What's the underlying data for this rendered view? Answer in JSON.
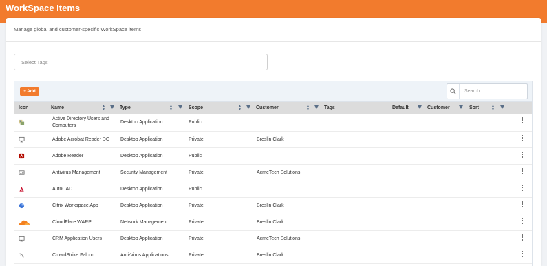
{
  "header": {
    "title": "WorkSpace Items"
  },
  "card": {
    "subtitle": "Manage global and customer-specific WorkSpace items",
    "tags_placeholder": "Select Tags"
  },
  "toolbar": {
    "add_label": "Add",
    "search_placeholder": "Search"
  },
  "columns": {
    "icon": "Icon",
    "name": "Name",
    "type": "Type",
    "scope": "Scope",
    "customer": "Customer",
    "tags": "Tags",
    "default": "Default",
    "customer2": "Customer",
    "sort": "Sort"
  },
  "rows": [
    {
      "icon": "directory-users-icon",
      "name": "Active Directory Users and Computers",
      "type": "Desktop Application",
      "scope": "Public",
      "customer": ""
    },
    {
      "icon": "desktop-monitor-icon",
      "name": "Adobe Acrobat Reader DC",
      "type": "Desktop Application",
      "scope": "Private",
      "customer": "Breslin Clark"
    },
    {
      "icon": "adobe-reader-icon",
      "name": "Adobe Reader",
      "type": "Desktop Application",
      "scope": "Public",
      "customer": ""
    },
    {
      "icon": "security-card-icon",
      "name": "Antivirus Management",
      "type": "Security Management",
      "scope": "Private",
      "customer": "AcmeTech Solutions"
    },
    {
      "icon": "autocad-icon",
      "name": "AutoCAD",
      "type": "Desktop Application",
      "scope": "Public",
      "customer": ""
    },
    {
      "icon": "citrix-icon",
      "name": "Citrix Workspace App",
      "type": "Desktop Application",
      "scope": "Private",
      "customer": "Breslin Clark"
    },
    {
      "icon": "cloudflare-icon",
      "name": "CloudFlare WARP",
      "type": "Network Management",
      "scope": "Private",
      "customer": "Breslin Clark"
    },
    {
      "icon": "desktop-monitor-icon",
      "name": "CRM Application Users",
      "type": "Desktop Application",
      "scope": "Private",
      "customer": "AcmeTech Solutions"
    },
    {
      "icon": "crowdstrike-icon",
      "name": "CrowdStrike Falcon",
      "type": "Anti-Virus Applications",
      "scope": "Private",
      "customer": "Breslin Clark"
    }
  ],
  "colors": {
    "accent": "#f27b2d",
    "header_bg": "#dcdcdc",
    "toolbar_bg": "#eef3f8"
  }
}
